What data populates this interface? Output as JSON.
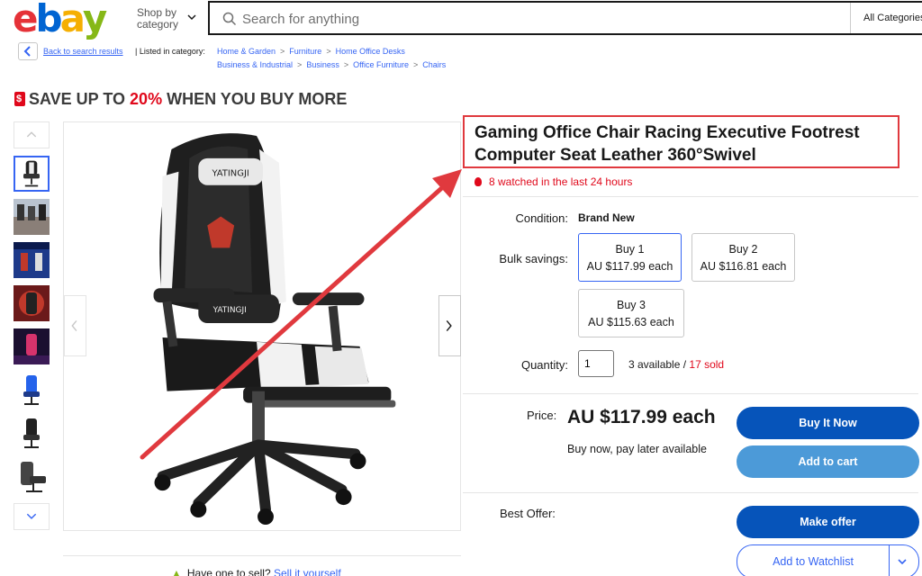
{
  "header": {
    "logo": [
      "e",
      "b",
      "a",
      "y"
    ],
    "logo_colors": [
      "#e53238",
      "#0064d2",
      "#f5af02",
      "#86b817"
    ],
    "shop_by_line1": "Shop by",
    "shop_by_line2": "category",
    "search_placeholder": "Search for anything",
    "category_select": "All Categories"
  },
  "breadcrumb": {
    "back_label": "Back to search results",
    "listed_in": "Listed in category:",
    "row1": [
      "Home & Garden",
      "Furniture",
      "Home Office Desks"
    ],
    "row2": [
      "Business & Industrial",
      "Business",
      "Office Furniture",
      "Chairs"
    ]
  },
  "banner": {
    "prefix": "SAVE UP TO ",
    "percent": "20%",
    "suffix": " WHEN YOU BUY MORE"
  },
  "product": {
    "title": "Gaming Office Chair Racing Executive Footrest Computer Seat Leather 360°Swivel",
    "watched": "8 watched in the last 24 hours",
    "condition_label": "Condition:",
    "condition_value": "Brand New",
    "bulk_label": "Bulk savings:",
    "bulk_options": [
      {
        "qty": "Buy 1",
        "price": "AU $117.99 each",
        "selected": true
      },
      {
        "qty": "Buy 2",
        "price": "AU $116.81 each",
        "selected": false
      },
      {
        "qty": "Buy 3",
        "price": "AU $115.63 each",
        "selected": false
      }
    ],
    "quantity_label": "Quantity:",
    "quantity_value": "1",
    "available": "3 available / ",
    "sold": "17 sold",
    "price_label": "Price:",
    "price": "AU $117.99 each",
    "pay_later": "Buy now, pay later available",
    "best_offer_label": "Best Offer:"
  },
  "buttons": {
    "buy_now": "Buy It Now",
    "add_to_cart": "Add to cart",
    "make_offer": "Make offer",
    "watchlist": "Add to Watchlist"
  },
  "image": {
    "brand_text": "YATINGJI",
    "brand_text_2": "YATINGJI"
  },
  "sell": {
    "prefix": "Have one to sell?",
    "link": "Sell it yourself"
  },
  "colors": {
    "accent_blue": "#0654ba",
    "light_blue": "#4c9ad8",
    "link_blue": "#3665f3",
    "sale_red": "#e0081b",
    "annotation_red": "#e0393e"
  }
}
